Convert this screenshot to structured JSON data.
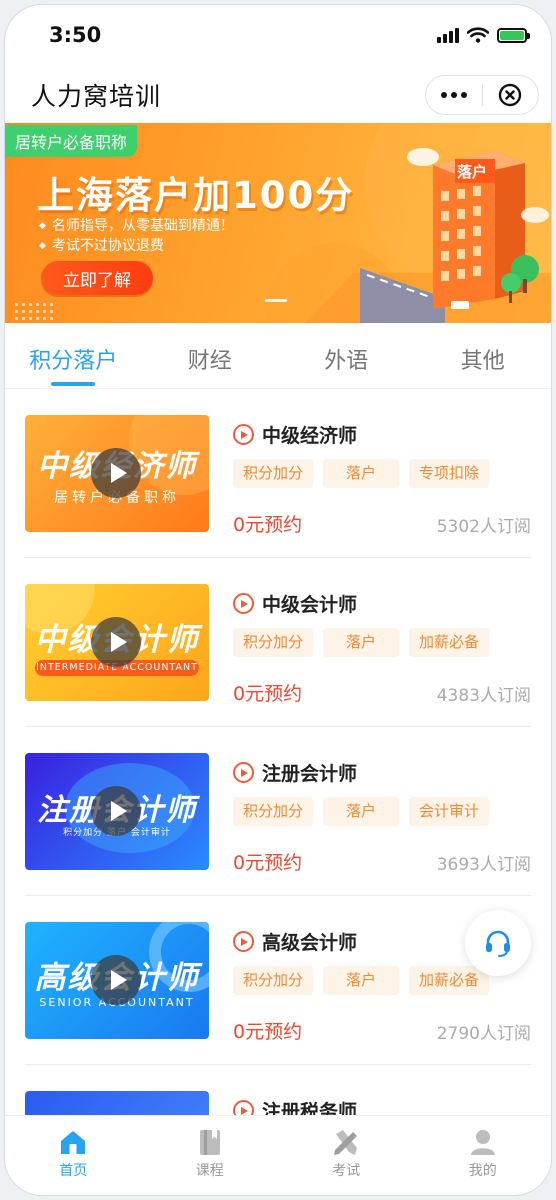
{
  "status_bar": {
    "time": "3:50"
  },
  "nav": {
    "title": "人力窝培训"
  },
  "banner": {
    "tag": "居转户必备职称",
    "headline": "上海落户加100分",
    "bullets": [
      "名师指导，从零基础到精通！",
      "考试不过协议退费"
    ],
    "button": "立即了解",
    "building_sign": "落户"
  },
  "tabs": [
    {
      "label": "积分落户",
      "active": true
    },
    {
      "label": "财经",
      "active": false
    },
    {
      "label": "外语",
      "active": false
    },
    {
      "label": "其他",
      "active": false
    }
  ],
  "courses": [
    {
      "title": "中级经济师",
      "thumb_title": "中级经济师",
      "thumb_sub": "居转户必备职称",
      "tags": [
        "积分加分",
        "落户",
        "专项扣除"
      ],
      "price": "0元预约",
      "subscribers": "5302人订阅"
    },
    {
      "title": "中级会计师",
      "thumb_title": "中级会计师",
      "thumb_sub": "INTERMEDIATE ACCOUNTANT",
      "tags": [
        "积分加分",
        "落户",
        "加薪必备"
      ],
      "price": "0元预约",
      "subscribers": "4383人订阅"
    },
    {
      "title": "注册会计师",
      "thumb_title": "注册会计师",
      "thumb_sub": "积分加分  落户  会计审计",
      "tags": [
        "积分加分",
        "落户",
        "会计审计"
      ],
      "price": "0元预约",
      "subscribers": "3693人订阅"
    },
    {
      "title": "高级会计师",
      "thumb_title": "高级会计师",
      "thumb_sub": "SENIOR ACCOUNTANT",
      "tags": [
        "积分加分",
        "落户",
        "加薪必备"
      ],
      "price": "0元预约",
      "subscribers": "2790人订阅"
    },
    {
      "title": "注册税务师",
      "thumb_title": "",
      "thumb_sub": "",
      "tags": [],
      "price": "",
      "subscribers": ""
    }
  ],
  "bottom_nav": [
    {
      "label": "首页",
      "icon": "home-icon",
      "active": true
    },
    {
      "label": "课程",
      "icon": "book-icon",
      "active": false
    },
    {
      "label": "考试",
      "icon": "exam-pencil-icon",
      "active": false
    },
    {
      "label": "我的",
      "icon": "user-icon",
      "active": false
    }
  ],
  "colors": {
    "accent": "#27a3f0",
    "price": "#f0472f",
    "tag_text": "#ef8a36",
    "tag_bg": "#fdf3e6"
  }
}
